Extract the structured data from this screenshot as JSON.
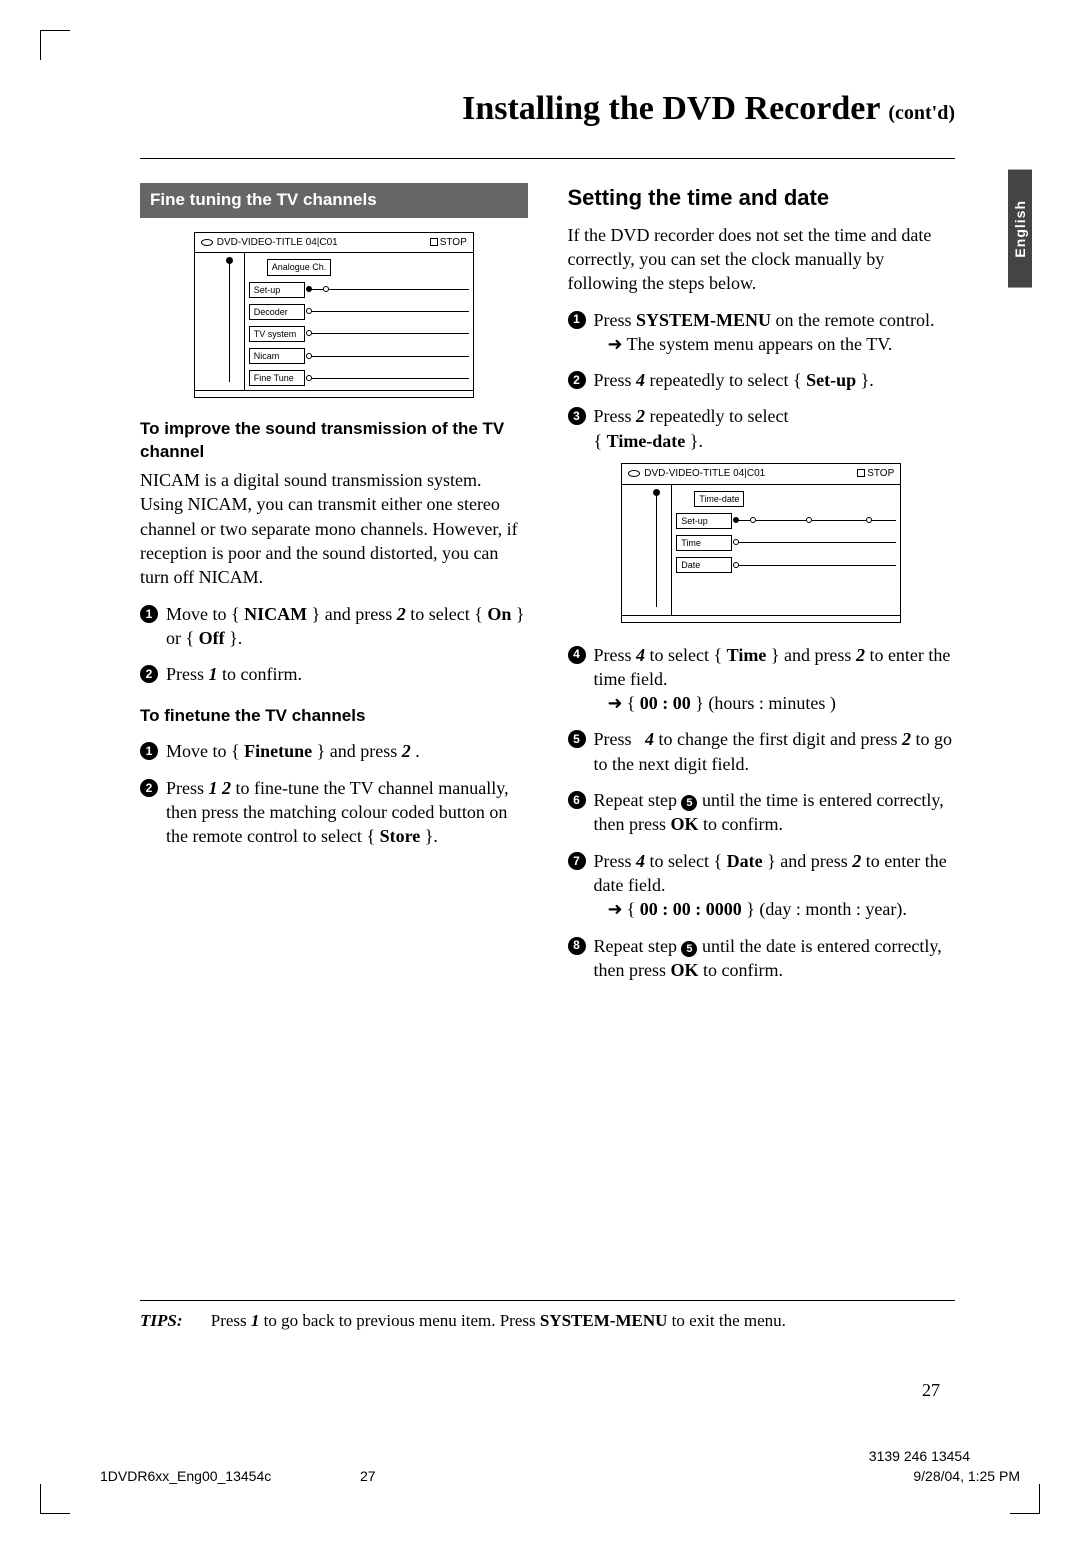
{
  "language_tab": "English",
  "title": {
    "main": "Installing the DVD Recorder ",
    "suffix": "(cont'd)"
  },
  "left": {
    "section_bar": "Fine tuning the TV channels",
    "sound": {
      "heading": "To improve the sound transmission of the TV channel",
      "para": "NICAM is a digital sound transmission system.  Using NICAM, you can transmit either one stereo channel or two separate mono channels.  However, if reception is poor and the sound distorted, you can turn off NICAM.",
      "step1": {
        "a": "Move to",
        "key1": "NICAM",
        "b": "and press",
        "key2": "2",
        "c": "to select",
        "on": "On",
        "or": "or",
        "off": "Off"
      },
      "step2": {
        "a": "Press",
        "key": "1",
        "b": "to confirm."
      }
    },
    "finetune": {
      "heading": "To finetune the TV channels",
      "step1": {
        "a": "Move to",
        "key": "Finetune",
        "b": "and press",
        "btn": "2"
      },
      "step2": {
        "a": "Press",
        "btn": "1 2",
        "b": "to fine-tune the TV channel manually, then press the matching colour coded button on the remote control to select",
        "key": "Store"
      }
    }
  },
  "right": {
    "heading": "Setting the time and date",
    "intro": "If the DVD recorder does not set the time and date correctly, you can set the clock manually by following the steps below.",
    "step1": {
      "a": "Press",
      "key": "SYSTEM-MENU",
      "b": "on the remote control.",
      "result": "The system menu appears on the TV."
    },
    "step2": {
      "a": "Press",
      "btn": "4",
      "b": "repeatedly to select",
      "key": "Set-up"
    },
    "step3": {
      "a": "Press",
      "btn": "2",
      "b": "repeatedly to select",
      "key": "Time-date"
    },
    "step4": {
      "a": "Press",
      "btn1": "4",
      "b": "to select",
      "key": "Time",
      "c": "and press",
      "btn2": "2",
      "d": "to enter the time field.",
      "val": "00 : 00",
      "hint": "(hours : minutes )"
    },
    "step5": {
      "a": "Press",
      "btn1": "4",
      "b": "to change the first digit and press",
      "btn2": "2",
      "c": "to go to the next digit field."
    },
    "step6": {
      "a": "Repeat step",
      "b": "until the time is entered correctly, then press",
      "key": "OK",
      "c": "to confirm."
    },
    "step7": {
      "a": "Press",
      "btn1": "4",
      "b": "to select",
      "key": "Date",
      "c": "and press",
      "btn2": "2",
      "d": "to enter the date field.",
      "val": "00 : 00 : 0000",
      "hint": "(day : month : year)."
    },
    "step8": {
      "a": "Repeat step",
      "b": "until the date is entered correctly, then press",
      "key": "OK",
      "c": "to confirm."
    }
  },
  "osd1": {
    "title": "DVD-VIDEO-TITLE 04|C01",
    "stop": "STOP",
    "tag": "Analogue Ch.",
    "rows": [
      "Set-up",
      "Decoder",
      "TV system",
      "Nicam",
      "Fine Tune"
    ]
  },
  "osd2": {
    "title": "DVD-VIDEO-TITLE 04|C01",
    "stop": "STOP",
    "tag": "Time-date",
    "rows": [
      "Set-up",
      "Time",
      "Date"
    ]
  },
  "tips": {
    "label": "TIPS:",
    "a": "Press",
    "btn": "1",
    "b": "to go back to previous menu item.  Press",
    "key": "SYSTEM-MENU",
    "c": "to exit the menu."
  },
  "page_number": "27",
  "footer": {
    "file": "1DVDR6xx_Eng00_13454c",
    "page": "27",
    "date": "9/28/04, 1:25 PM",
    "code": "3139 246 13454"
  }
}
